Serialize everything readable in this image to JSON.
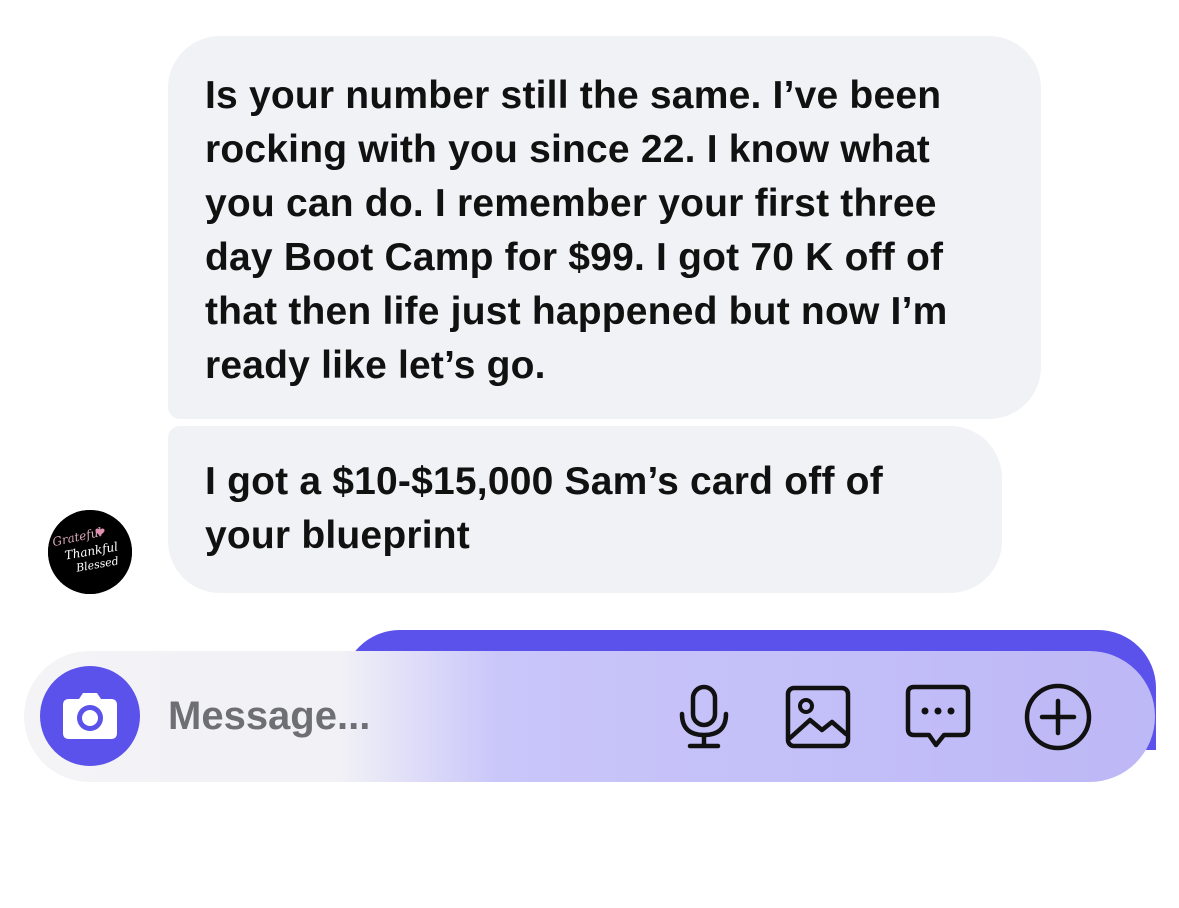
{
  "conversation": {
    "messages": [
      {
        "direction": "incoming",
        "text": "Is your number still the same. I’ve been rocking with you since 22. I know what you can do. I remember your first three day Boot Camp for $99. I got 70 K off of that then life just happened but now I’m ready like let’s go."
      },
      {
        "direction": "incoming",
        "text": "I got a $10-$15,000 Sam’s card off of your blueprint"
      }
    ],
    "avatar": {
      "line1": "Grateful",
      "line2": "Thankful",
      "line3": "Blessed"
    }
  },
  "composer": {
    "placeholder": "Message...",
    "icons": {
      "camera": "camera-icon",
      "mic": "microphone-icon",
      "gallery": "image-icon",
      "chat": "chat-bubble-icon",
      "add": "plus-circle-icon"
    }
  },
  "colors": {
    "incoming_bubble": "#f1f2f5",
    "accent": "#5a52ea",
    "composer_tint": "#c3bff8",
    "text": "#111111",
    "placeholder": "#6e6e75"
  }
}
